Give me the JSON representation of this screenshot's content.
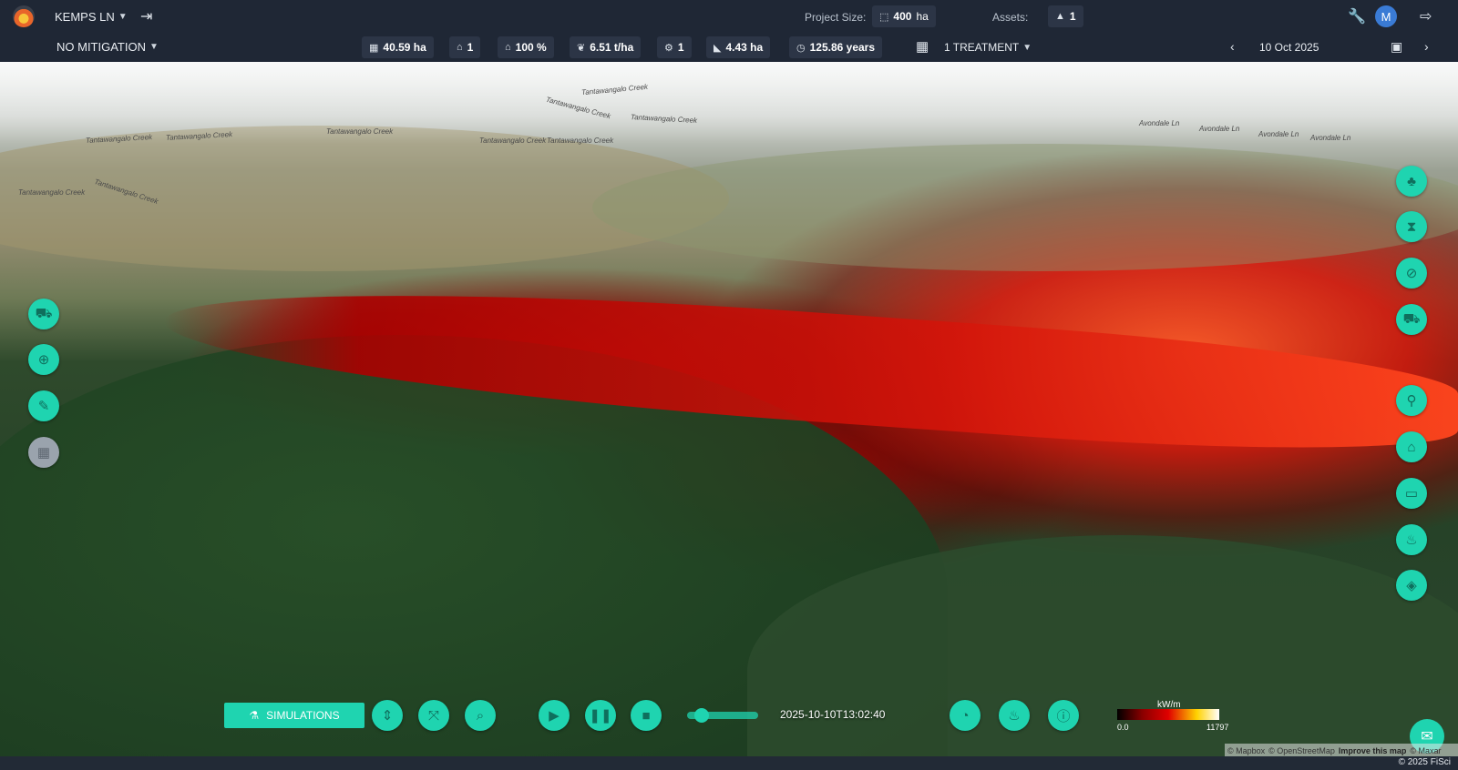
{
  "header": {
    "project_name": "KEMPS LN",
    "project_size_label": "Project Size:",
    "project_size_value": "400",
    "project_size_unit": "ha",
    "assets_label": "Assets:",
    "assets_value": "1",
    "avatar_initial": "M"
  },
  "subheader": {
    "mitigation": "NO MITIGATION",
    "stats": [
      {
        "icon": "area-icon",
        "glyph": "▦",
        "value": "40.59 ha"
      },
      {
        "icon": "house-icon",
        "glyph": "⌂",
        "value": "1"
      },
      {
        "icon": "house-percent-icon",
        "glyph": "⌂",
        "value": "100 %"
      },
      {
        "icon": "fuel-load-icon",
        "glyph": "❦",
        "value": "6.51 t/ha"
      },
      {
        "icon": "vehicle-icon",
        "glyph": "⚙",
        "value": "1"
      },
      {
        "icon": "slope-area-icon",
        "glyph": "◣",
        "value": "4.43 ha"
      },
      {
        "icon": "clock-icon",
        "glyph": "◷",
        "value": "125.86 years"
      }
    ],
    "treatment": "1 TREATMENT",
    "date": "10 Oct 2025"
  },
  "map_labels": [
    "Tantawangalo Creek",
    "Tantawangalo Creek",
    "Tantawangalo Creek",
    "Tantawangalo Creek",
    "Tantawangalo Creek",
    "Tantawangalo Creek",
    "Tantawangalo Creek",
    "Tantawangalo Creek",
    "Tantawangalo Creek",
    "Tantawangalo Creek",
    "Avondale Ln",
    "Avondale Ln",
    "Avondale Ln",
    "Avondale Ln"
  ],
  "simulation": {
    "button_label": "SIMULATIONS",
    "timestamp": "2025-10-10T13:02:40",
    "progress": 0.2
  },
  "legend": {
    "title": "kW/m",
    "min": "0.0",
    "max": "11797"
  },
  "attribution": {
    "mapbox": "© Mapbox",
    "osm": "© OpenStreetMap",
    "improve": "Improve this map",
    "maxar": "© Maxar"
  },
  "footer": {
    "copyright": "© 2025 FiSci"
  },
  "colors": {
    "accent": "#1fd4b0",
    "header_bg": "#1f2735"
  }
}
